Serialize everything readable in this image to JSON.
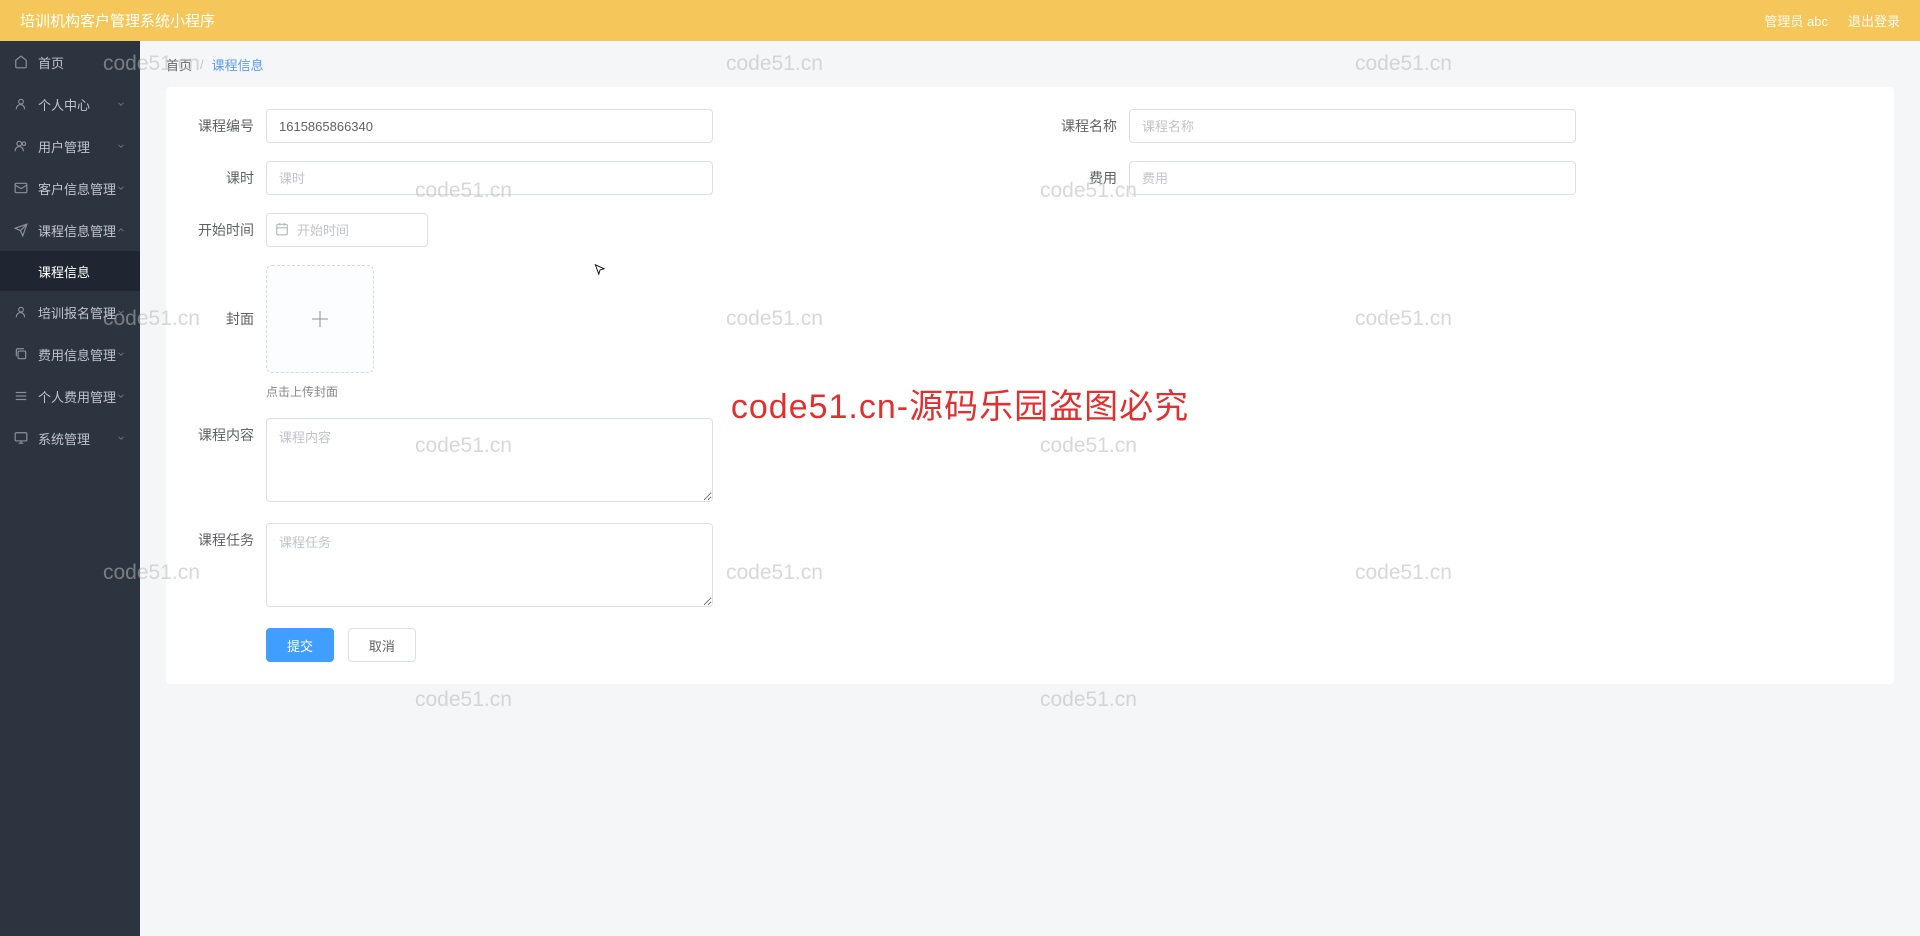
{
  "header": {
    "title": "培训机构客户管理系统小程序",
    "admin_label": "管理员 abc",
    "logout_label": "退出登录"
  },
  "sidebar": {
    "items": [
      {
        "icon": "home",
        "label": "首页",
        "expandable": false
      },
      {
        "icon": "user",
        "label": "个人中心",
        "expandable": true
      },
      {
        "icon": "users",
        "label": "用户管理",
        "expandable": true
      },
      {
        "icon": "mail",
        "label": "客户信息管理",
        "expandable": true
      },
      {
        "icon": "send",
        "label": "课程信息管理",
        "expandable": true,
        "expanded": true,
        "children": [
          {
            "label": "课程信息"
          }
        ]
      },
      {
        "icon": "user",
        "label": "培训报名管理",
        "expandable": true
      },
      {
        "icon": "copy",
        "label": "费用信息管理",
        "expandable": true
      },
      {
        "icon": "bars",
        "label": "个人费用管理",
        "expandable": true
      },
      {
        "icon": "monitor",
        "label": "系统管理",
        "expandable": true
      }
    ]
  },
  "breadcrumb": {
    "home": "首页",
    "current": "课程信息"
  },
  "form": {
    "course_id": {
      "label": "课程编号",
      "value": "1615865866340"
    },
    "course_name": {
      "label": "课程名称",
      "placeholder": "课程名称"
    },
    "hours": {
      "label": "课时",
      "placeholder": "课时"
    },
    "fee": {
      "label": "费用",
      "placeholder": "费用"
    },
    "start_time": {
      "label": "开始时间",
      "placeholder": "开始时间"
    },
    "cover": {
      "label": "封面",
      "hint": "点击上传封面"
    },
    "content": {
      "label": "课程内容",
      "placeholder": "课程内容"
    },
    "tasks": {
      "label": "课程任务",
      "placeholder": "课程任务"
    }
  },
  "buttons": {
    "submit": "提交",
    "cancel": "取消"
  },
  "watermark": {
    "text": "code51.cn",
    "red_text": "code51.cn-源码乐园盗图必究"
  }
}
